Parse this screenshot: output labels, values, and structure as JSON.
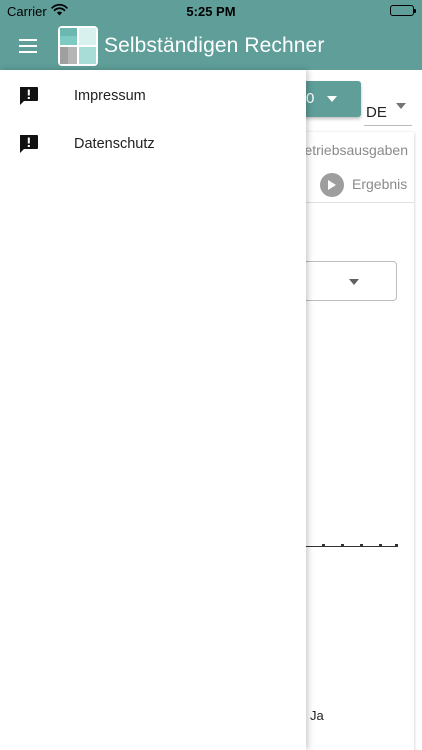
{
  "status_bar": {
    "carrier": "Carrier",
    "time": "5:25 PM",
    "wifi_icon": "wifi-icon",
    "battery_icon": "battery-icon"
  },
  "app_bar": {
    "title": "Selbständigen Rechner",
    "menu_icon": "hamburger-menu-icon",
    "logo_icon": "app-logo-icon",
    "background_color": "#5f9e99",
    "text_color": "#ffffff"
  },
  "drawer": {
    "items": [
      {
        "label": "Impressum",
        "icon": "report-feedback-icon"
      },
      {
        "label": "Datenschutz",
        "icon": "report-feedback-icon"
      }
    ]
  },
  "background": {
    "dropdown_button_text": "0",
    "language_select_value": "DE",
    "stepper": {
      "step_previous_label": "Betriebsausgaben",
      "step_current_label": "Ergebnis"
    },
    "chart_axis_label": "Ja"
  },
  "colors": {
    "accent": "#5f9e99",
    "inactive_step": "#9e9e9e",
    "text_primary": "#212121",
    "text_secondary": "#8a8a8a"
  }
}
